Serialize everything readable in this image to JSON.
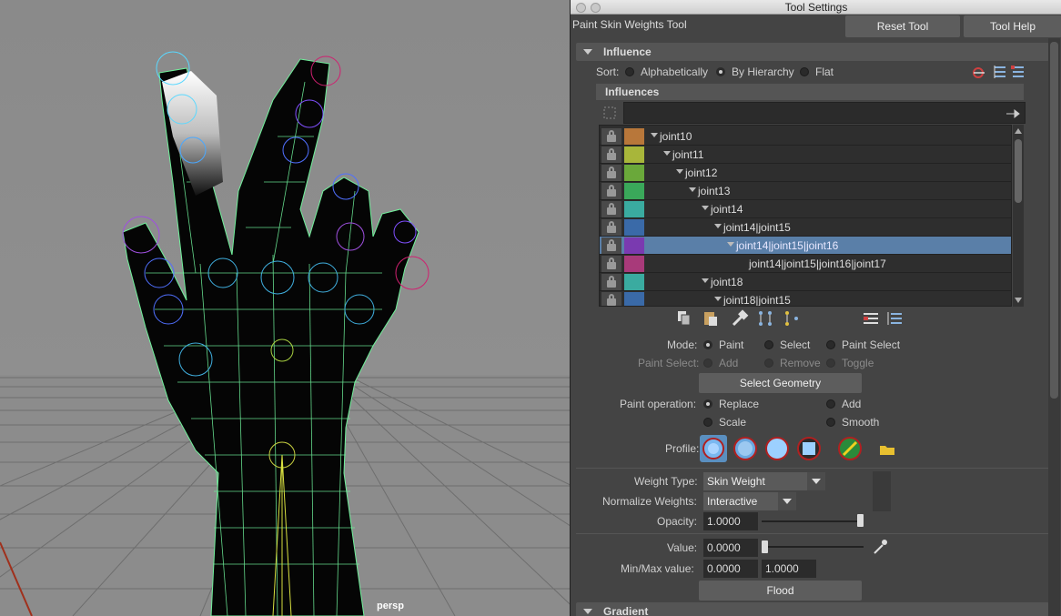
{
  "viewport": {
    "camera_label": "persp"
  },
  "window": {
    "title": "Tool Settings"
  },
  "tool": {
    "name": "Paint Skin Weights Tool",
    "reset_label": "Reset Tool",
    "help_label": "Tool Help"
  },
  "influence": {
    "section_label": "Influence",
    "sort_label": "Sort:",
    "sort_options": [
      "Alphabetically",
      "By Hierarchy",
      "Flat"
    ],
    "sort_selected": "By Hierarchy",
    "list_header": "Influences",
    "rows": [
      {
        "name": "joint10",
        "color": "#b8773a",
        "depth": 0,
        "expanded": true,
        "selected": false
      },
      {
        "name": "joint11",
        "color": "#a8b63a",
        "depth": 1,
        "expanded": true,
        "selected": false
      },
      {
        "name": "joint12",
        "color": "#6aa83a",
        "depth": 2,
        "expanded": true,
        "selected": false
      },
      {
        "name": "joint13",
        "color": "#3aa85a",
        "depth": 3,
        "expanded": true,
        "selected": false
      },
      {
        "name": "joint14",
        "color": "#3aaba0",
        "depth": 4,
        "expanded": true,
        "selected": false
      },
      {
        "name": "joint14|joint15",
        "color": "#3a6aa8",
        "depth": 5,
        "expanded": true,
        "selected": false
      },
      {
        "name": "joint14|joint15|joint16",
        "color": "#7a3ab0",
        "depth": 6,
        "expanded": true,
        "selected": true
      },
      {
        "name": "joint14|joint15|joint16|joint17",
        "color": "#a83a7a",
        "depth": 7,
        "expanded": false,
        "selected": false
      },
      {
        "name": "joint18",
        "color": "#3aaba0",
        "depth": 4,
        "expanded": true,
        "selected": false
      },
      {
        "name": "joint18|joint15",
        "color": "#3a6aa8",
        "depth": 5,
        "expanded": true,
        "selected": false
      }
    ]
  },
  "mode": {
    "label": "Mode:",
    "options": [
      "Paint",
      "Select",
      "Paint Select"
    ],
    "selected": "Paint",
    "paint_select_label": "Paint Select:",
    "paint_select_options": [
      "Add",
      "Remove",
      "Toggle"
    ],
    "select_geometry_label": "Select Geometry"
  },
  "paint_operation": {
    "label": "Paint operation:",
    "options": [
      "Replace",
      "Add",
      "Scale",
      "Smooth"
    ],
    "selected": "Replace"
  },
  "profile": {
    "label": "Profile:"
  },
  "weights": {
    "weight_type_label": "Weight Type:",
    "weight_type_value": "Skin Weight",
    "normalize_label": "Normalize Weights:",
    "normalize_value": "Interactive",
    "opacity_label": "Opacity:",
    "opacity_value": "1.0000",
    "opacity_level": 1.0,
    "value_label": "Value:",
    "value_value": "0.0000",
    "value_level": 0.0,
    "minmax_label": "Min/Max value:",
    "min_value": "0.0000",
    "max_value": "1.0000",
    "flood_label": "Flood"
  },
  "gradient": {
    "section_label": "Gradient"
  }
}
